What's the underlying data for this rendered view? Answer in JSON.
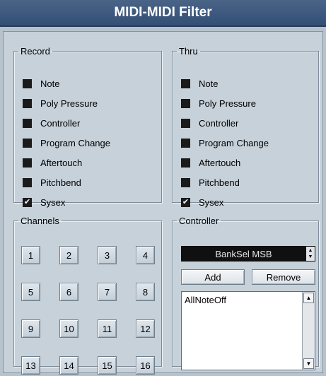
{
  "window": {
    "title": "MIDI-MIDI Filter"
  },
  "record": {
    "legend": "Record",
    "items": [
      {
        "label": "Note",
        "checked": false
      },
      {
        "label": "Poly Pressure",
        "checked": false
      },
      {
        "label": "Controller",
        "checked": false
      },
      {
        "label": "Program Change",
        "checked": false
      },
      {
        "label": "Aftertouch",
        "checked": false
      },
      {
        "label": "Pitchbend",
        "checked": false
      },
      {
        "label": "Sysex",
        "checked": true
      }
    ]
  },
  "thru": {
    "legend": "Thru",
    "items": [
      {
        "label": "Note",
        "checked": false
      },
      {
        "label": "Poly Pressure",
        "checked": false
      },
      {
        "label": "Controller",
        "checked": false
      },
      {
        "label": "Program Change",
        "checked": false
      },
      {
        "label": "Aftertouch",
        "checked": false
      },
      {
        "label": "Pitchbend",
        "checked": false
      },
      {
        "label": "Sysex",
        "checked": true
      }
    ]
  },
  "channels": {
    "legend": "Channels",
    "buttons": [
      "1",
      "2",
      "3",
      "4",
      "5",
      "6",
      "7",
      "8",
      "9",
      "10",
      "11",
      "12",
      "13",
      "14",
      "15",
      "16"
    ]
  },
  "controller": {
    "legend": "Controller",
    "selected": "BankSel MSB",
    "add_label": "Add",
    "remove_label": "Remove",
    "list": [
      "AllNoteOff"
    ]
  },
  "colors": {
    "titlebar": "#3c5880",
    "background": "#b6c2cc",
    "checkbox": "#1a1a1a"
  },
  "icons": {
    "check": "checkmark-icon",
    "spinner": "up-down-spinner-icon",
    "scroll_up": "scroll-up-arrow-icon",
    "scroll_down": "scroll-down-arrow-icon"
  }
}
